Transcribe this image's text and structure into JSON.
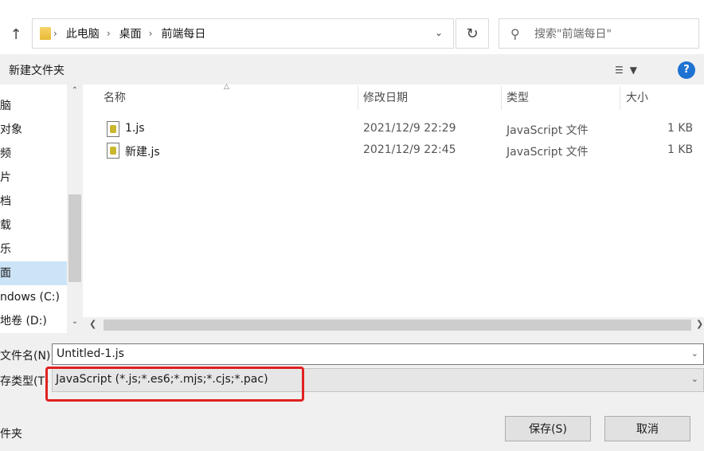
{
  "address": {
    "crumbs": [
      "此电脑",
      "桌面",
      "前端每日"
    ],
    "search_placeholder": "搜索\"前端每日\""
  },
  "toolbar": {
    "new_folder": "新建文件夹",
    "help": "?"
  },
  "nav": {
    "items": [
      "脑",
      "对象",
      "频",
      "片",
      "档",
      "载",
      "乐",
      "面",
      "ndows (C:)",
      "地卷 (D:)"
    ],
    "selected_index": 7
  },
  "filelist": {
    "columns": [
      "名称",
      "修改日期",
      "类型",
      "大小"
    ],
    "rows": [
      {
        "name": "1.js",
        "modified": "2021/12/9 22:29",
        "type": "JavaScript 文件",
        "size": "1 KB"
      },
      {
        "name": "新建.js",
        "modified": "2021/12/9 22:45",
        "type": "JavaScript 文件",
        "size": "1 KB"
      }
    ]
  },
  "form": {
    "filename_label": "文件名(N):",
    "filename_value": "Untitled-1.js",
    "filetype_label": "存类型(T)",
    "filetype_value": "JavaScript (*.js;*.es6;*.mjs;*.cjs;*.pac)"
  },
  "footer": {
    "hide_folders": "件夹",
    "save": "保存(S)",
    "cancel": "取消"
  },
  "colors": {
    "accent": "#1e72d2",
    "selection": "#cce4f7",
    "highlight_border": "#e02020"
  }
}
